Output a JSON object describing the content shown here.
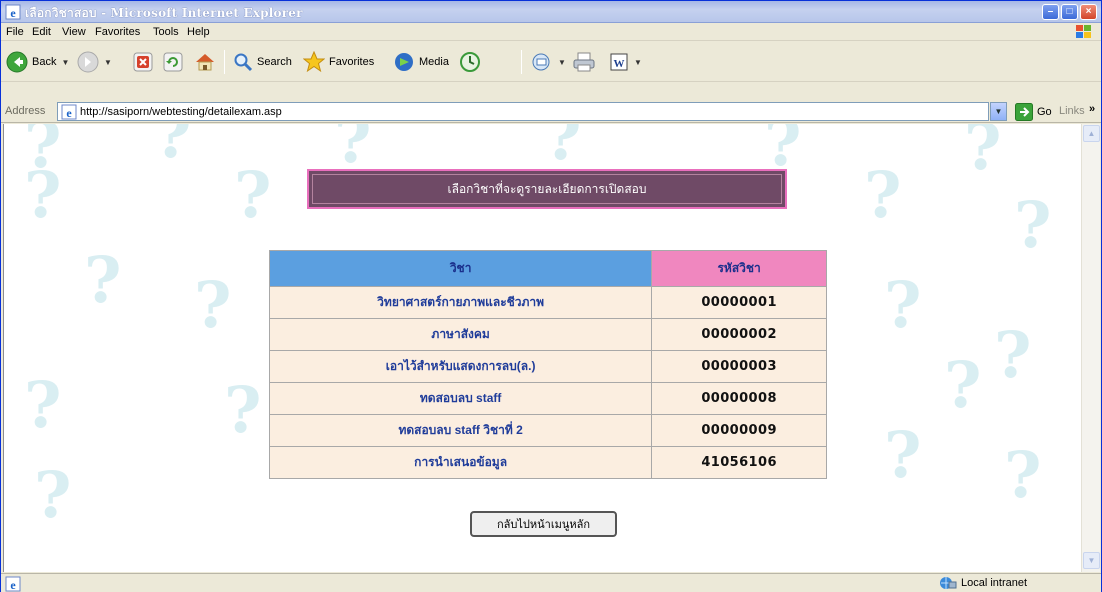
{
  "window": {
    "title": "เลือกวิชาสอบ - Microsoft Internet Explorer",
    "controls": [
      "minimize",
      "maximize",
      "close"
    ]
  },
  "menu": [
    "File",
    "Edit",
    "View",
    "Favorites",
    "Tools",
    "Help"
  ],
  "toolbar": {
    "back_label": "Back",
    "search_label": "Search",
    "favorites_label": "Favorites",
    "media_label": "Media"
  },
  "address": {
    "label": "Address",
    "url": "http://sasiporn/webtesting/detailexam.asp",
    "go_label": "Go",
    "links_label": "Links",
    "links_chevron": "»"
  },
  "page": {
    "banner_text": "เลือกวิชาที่จะดูรายละเอียดการเปิดสอบ",
    "table": {
      "headers": [
        "วิชา",
        "รหัสวิชา"
      ],
      "rows": [
        {
          "name": "วิทยาศาสตร์กายภาพและชีวภาพ",
          "code": "00000001"
        },
        {
          "name": "ภาษาสังคม",
          "code": "00000002"
        },
        {
          "name": "เอาไว้สำหรับแสดงการลบ(ล.)",
          "code": "00000003"
        },
        {
          "name": "ทดสอบลบ staff",
          "code": "00000008"
        },
        {
          "name": "ทดสอบลบ staff วิชาที่ 2",
          "code": "00000009"
        },
        {
          "name": "การนำเสนอข้อมูล",
          "code": "41056106"
        }
      ]
    },
    "back_button_label": "กลับไปหน้าเมนูหลัก"
  },
  "status": {
    "zone_label": "Local intranet"
  },
  "colors": {
    "header_subject_bg": "#5b9fe0",
    "header_code_bg": "#f087bf",
    "banner_bg": "#6f4a66",
    "banner_border": "#e96fbd",
    "row_bg": "#fbeee0",
    "link_text": "#1f3c9a"
  },
  "icons": [
    "ie-page-icon",
    "back-arrow-icon",
    "forward-arrow-icon",
    "stop-icon",
    "refresh-icon",
    "home-icon",
    "search-icon",
    "favorites-star-icon",
    "media-icon",
    "history-icon",
    "mail-icon",
    "print-icon",
    "edit-icon",
    "go-arrow-icon",
    "local-intranet-icon",
    "question-mark-background"
  ]
}
